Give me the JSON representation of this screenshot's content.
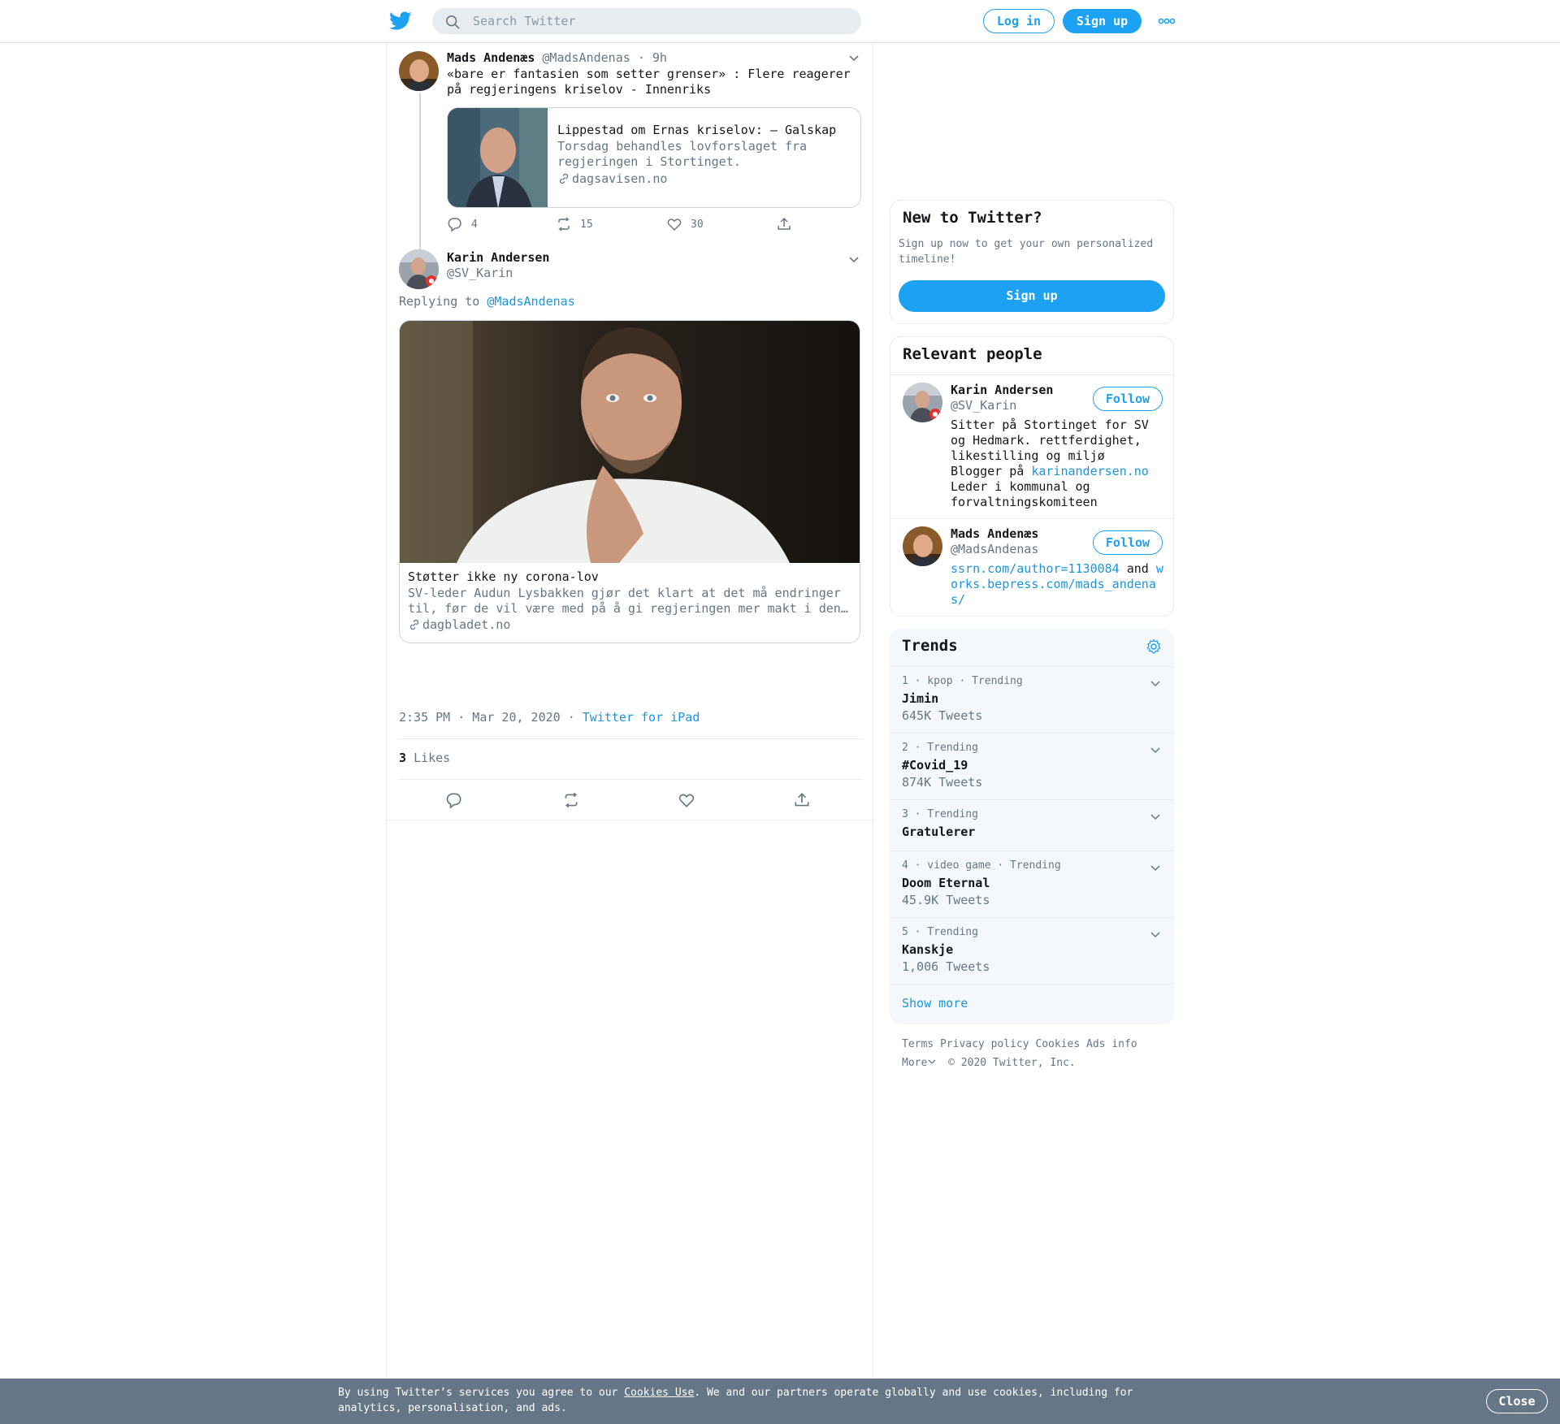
{
  "topbar": {
    "search_placeholder": "Search Twitter",
    "login_label": "Log in",
    "signup_label": "Sign up"
  },
  "parent_tweet": {
    "name": "Mads Andenæs",
    "handle": "@MadsAndenas",
    "time": "· 9h",
    "text": "«bare er fantasien som setter grenser» : Flere reagerer på regjeringens kriselov - Innenriks",
    "card": {
      "title": "Lippestad om Ernas kriselov: – Galskap",
      "description": "Torsdag behandles lovforslaget fra regjeringen i Stortinget.",
      "domain": "dagsavisen.no"
    },
    "replies": "4",
    "retweets": "15",
    "likes": "30"
  },
  "main_tweet": {
    "name": "Karin Andersen",
    "handle": "@SV_Karin",
    "replying_prefix": "Replying to",
    "replying_to": "@MadsAndenas",
    "card": {
      "title": "Støtter ikke ny corona-lov",
      "description": "SV-leder Audun Lysbakken gjør det klart at det må endringer til, før de vil være med på å gi regjeringen mer makt i den…",
      "domain": "dagbladet.no"
    },
    "timestamp": "2:35 PM · Mar 20, 2020",
    "separator": "·",
    "source": "Twitter for iPad",
    "likes_count": "3",
    "likes_label": "Likes"
  },
  "new_to_twitter": {
    "title": "New to Twitter?",
    "text": "Sign up now to get your own personalized timeline!",
    "button": "Sign up"
  },
  "relevant_people": {
    "title": "Relevant people",
    "people": [
      {
        "name": "Karin Andersen",
        "handle": "@SV_Karin",
        "follow": "Follow",
        "bio_1": "Sitter på Stortinget for SV og Hedmark. rettferdighet, likestilling og miljø",
        "bio_2_prefix": "Blogger på ",
        "bio_2_link": "karinandersen.no",
        "bio_3": "Leder i kommunal og forvaltningskomiteen"
      },
      {
        "name": "Mads Andenæs",
        "handle": "@MadsAndenas",
        "follow": "Follow",
        "bio_link_1": "ssrn.com/author=1130084",
        "bio_and": " and ",
        "bio_link_2": "works.bepress.com/mads_andenas/"
      }
    ]
  },
  "trends": {
    "title": "Trends",
    "items": [
      {
        "meta": "1 · kpop · Trending",
        "name": "Jimin",
        "count": "645K Tweets"
      },
      {
        "meta": "2 · Trending",
        "name": "#Covid_19",
        "count": "874K Tweets"
      },
      {
        "meta": "3 · Trending",
        "name": "Gratulerer",
        "count": ""
      },
      {
        "meta": "4 · video game · Trending",
        "name": "Doom Eternal",
        "count": "45.9K Tweets"
      },
      {
        "meta": "5 · Trending",
        "name": "Kanskje",
        "count": "1,006 Tweets"
      }
    ],
    "show_more": "Show more"
  },
  "footer": {
    "terms": "Terms",
    "privacy": "Privacy policy",
    "cookies": "Cookies",
    "ads": "Ads info",
    "more": "More",
    "copyright": "© 2020 Twitter, Inc."
  },
  "cookie_bar": {
    "text_before": "By using Twitter’s services you agree to our ",
    "link": "Cookies Use",
    "text_after": ". We and our partners operate globally and use cookies, including for analytics, personalisation, and ads.",
    "close": "Close"
  },
  "colors": {
    "accent": "#1da1f2",
    "link": "#1b95e0",
    "muted": "#657786",
    "cookie_bar": "#657786"
  },
  "icons": [
    "twitter-bird-icon",
    "search-icon",
    "more-dots-icon",
    "chevron-down-icon",
    "reply-icon",
    "retweet-icon",
    "like-icon",
    "share-icon",
    "link-icon",
    "settings-gear-icon"
  ]
}
